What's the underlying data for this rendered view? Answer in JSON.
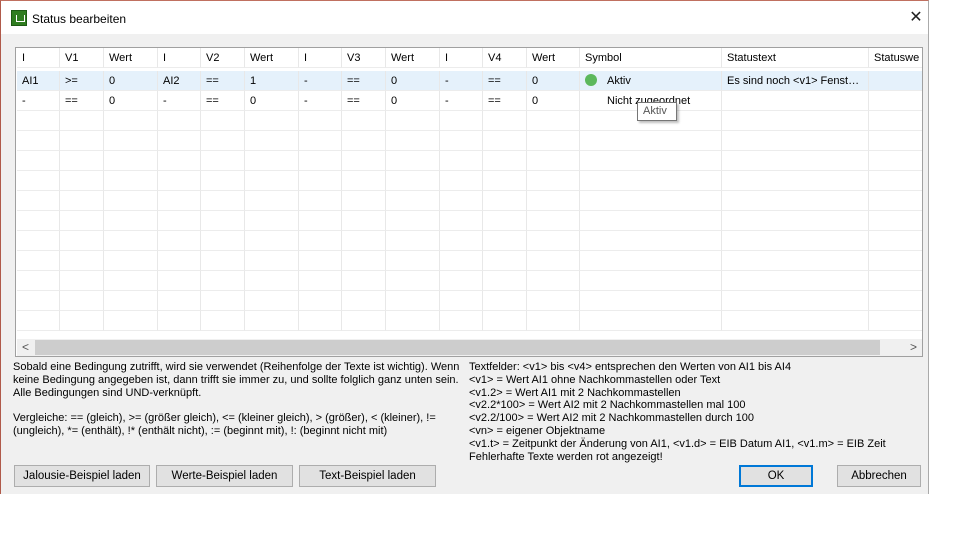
{
  "window": {
    "title": "Status bearbeiten",
    "close_icon": "close-icon"
  },
  "table": {
    "columns": [
      "I",
      "V1",
      "Wert",
      "I",
      "V2",
      "Wert",
      "I",
      "V3",
      "Wert",
      "I",
      "V4",
      "Wert",
      "Symbol",
      "Statustext",
      "Statuswe"
    ],
    "rows": [
      [
        "AI1",
        ">=",
        "0",
        "AI2",
        "==",
        "1",
        "-",
        "==",
        "0",
        "-",
        "==",
        "0",
        "Aktiv",
        "Es sind noch <v1> Fenst…",
        ""
      ],
      [
        "-",
        "==",
        "0",
        "-",
        "==",
        "0",
        "-",
        "==",
        "0",
        "-",
        "==",
        "0",
        "Nicht zugeordnet",
        "",
        ""
      ]
    ],
    "selected_row": 0,
    "tooltip": "Aktiv",
    "symbol_color": "#5cb85c"
  },
  "help_left": [
    "Sobald eine Bedingung zutrifft, wird sie verwendet (Reihenfolge der Texte ist wichtig). Wenn",
    "keine Bedingung angegeben ist, dann trifft sie immer zu, und sollte folglich ganz unten sein.",
    "Alle Bedingungen sind UND-verknüpft.",
    "",
    "Vergleiche: == (gleich), >= (größer gleich), <= (kleiner gleich), > (größer), < (kleiner), !=",
    "(ungleich), *= (enthält), !* (enthält nicht), := (beginnt mit), !: (beginnt nicht mit)"
  ],
  "help_right": [
    "Textfelder: <v1> bis <v4> entsprechen den Werten von AI1 bis AI4",
    "<v1> = Wert AI1 ohne Nachkommastellen oder Text",
    "<v1.2> = Wert AI1 mit 2 Nachkommastellen",
    "<v2.2*100> = Wert AI2 mit 2 Nachkommastellen mal 100",
    "<v2.2/100> = Wert AI2 mit 2 Nachkommastellen durch 100",
    "<vn> = eigener Objektname",
    "<v1.t> = Zeitpunkt der Änderung von AI1, <v1.d> = EIB Datum AI1, <v1.m> = EIB Zeit",
    "Fehlerhafte Texte werden rot angezeigt!"
  ],
  "buttons": {
    "jalousie": "Jalousie-Beispiel laden",
    "werte": "Werte-Beispiel laden",
    "text": "Text-Beispiel laden",
    "ok": "OK",
    "cancel": "Abbrechen"
  },
  "scroll": {
    "left": "<",
    "right": ">"
  }
}
